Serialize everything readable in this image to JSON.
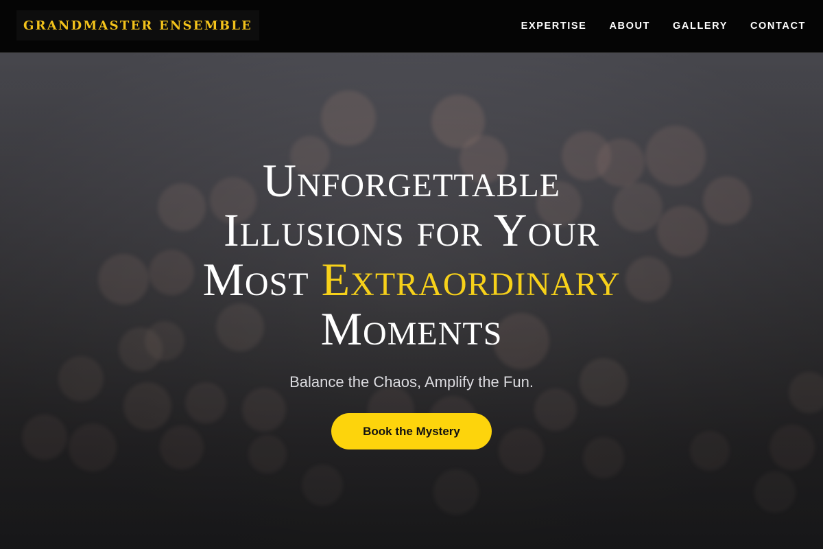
{
  "header": {
    "logo_text": "GRANDMASTER ENSEMBLE",
    "nav": [
      {
        "label": "EXPERTISE"
      },
      {
        "label": "ABOUT"
      },
      {
        "label": "GALLERY"
      },
      {
        "label": "CONTACT"
      }
    ]
  },
  "hero": {
    "headline_line1": "Unforgettable",
    "headline_line2": "Illusions for Your",
    "headline_line3_prefix": "Most ",
    "headline_accent": "Extraordinary",
    "headline_line4": "Moments",
    "tagline": "Balance the Chaos, Amplify the Fun.",
    "cta_label": "Book the Mystery"
  },
  "colors": {
    "accent": "#f7d11a",
    "cta_background": "#fdd40c",
    "header_background": "#050505",
    "logo_text": "#f2c21b"
  }
}
